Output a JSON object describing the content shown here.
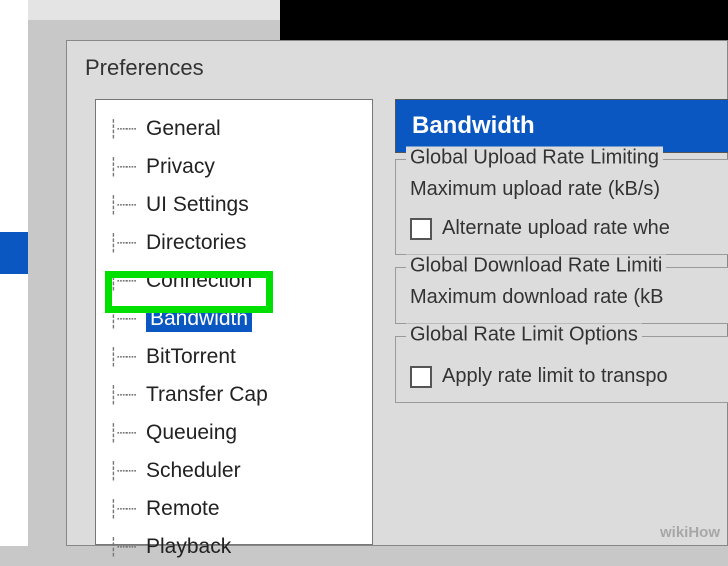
{
  "dialog": {
    "title": "Preferences"
  },
  "tree": {
    "items": [
      {
        "label": "General"
      },
      {
        "label": "Privacy"
      },
      {
        "label": "UI Settings"
      },
      {
        "label": "Directories"
      },
      {
        "label": "Connection"
      },
      {
        "label": "Bandwidth",
        "selected": true
      },
      {
        "label": "BitTorrent"
      },
      {
        "label": "Transfer Cap"
      },
      {
        "label": "Queueing"
      },
      {
        "label": "Scheduler"
      },
      {
        "label": "Remote"
      },
      {
        "label": "Playback"
      }
    ]
  },
  "pane": {
    "header": "Bandwidth",
    "group1": {
      "legend": "Global Upload Rate Limiting",
      "line1": "Maximum upload rate (kB/s)",
      "checkbox_label": "Alternate upload rate whe"
    },
    "group2": {
      "legend": "Global Download Rate Limiti",
      "line1": "Maximum download rate (kB"
    },
    "group3": {
      "legend": "Global Rate Limit Options",
      "checkbox_label": "Apply rate limit to transpo"
    }
  },
  "watermark": "wikiHow"
}
